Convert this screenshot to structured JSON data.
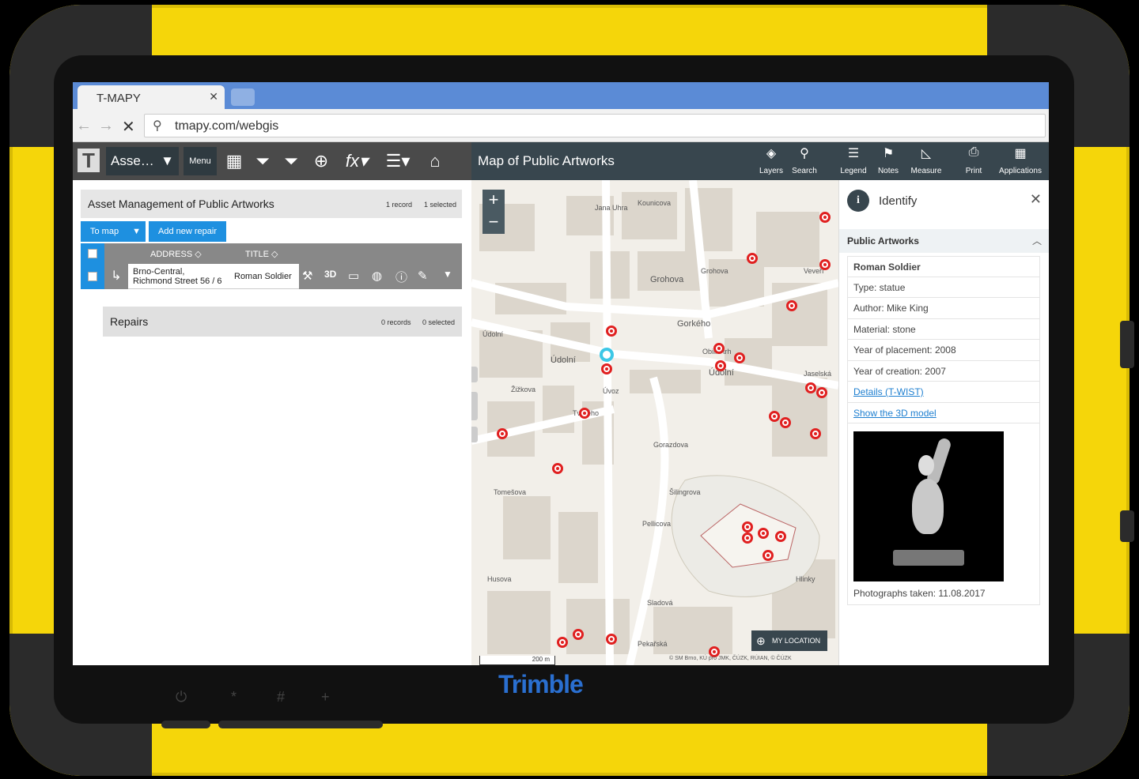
{
  "browser": {
    "tab_title": "T-MAPY",
    "url": "tmapy.com/webgis"
  },
  "device": {
    "brand": "Trimble",
    "frame_color": "#f5d60a"
  },
  "left_toolbar": {
    "asset_dropdown": "Asse…",
    "menu_label": "Menu"
  },
  "asset_panel": {
    "title": "Asset Management of Public Artworks",
    "records": "1 record",
    "selected": "1 selected",
    "to_map_label": "To map",
    "add_repair_label": "Add new repair",
    "columns": [
      "ADDRESS",
      "TITLE"
    ],
    "row": {
      "address_line1": "Brno-Central,",
      "address_line2": "Richmond Street 56 / 6",
      "title": "Roman Soldier"
    }
  },
  "repairs_panel": {
    "title": "Repairs",
    "records": "0 records",
    "selected": "0 selected"
  },
  "map_toolbar": {
    "title": "Map of Public Artworks",
    "buttons": [
      "Layers",
      "Search",
      "Legend",
      "Notes",
      "Measure",
      "Print",
      "Applications"
    ]
  },
  "map": {
    "my_location": "MY LOCATION",
    "scale": "200 m",
    "attribution": "© SM Brno, KÚ pro JMK, ČÚZK, RÚIAN, © ČÚZK",
    "streets": [
      "Jana Uhra",
      "Grohova",
      "Gorkého",
      "Údolní",
      "Obilní trh",
      "Úvoz",
      "Tvrdého",
      "Žižkova",
      "Gorazdova",
      "Tomešova",
      "Pellicova",
      "Šilingrova",
      "Údolní",
      "Pekařská",
      "Hlinky",
      "Sladová",
      "Jaselská",
      "Grohova",
      "Kounicova",
      "Veveří",
      "Husova",
      "Údolní"
    ],
    "accent_color": "#e02020"
  },
  "identify": {
    "title": "Identify",
    "group": "Public Artworks",
    "rows": [
      "Roman Soldier",
      "Type: statue",
      "Author: Mike King",
      "Material: stone",
      "Year of placement: 2008",
      "Year of creation: 2007"
    ],
    "links": [
      "Details (T-WIST)",
      "Show the 3D model"
    ],
    "photo_caption": "Photographs taken: 11.08.2017"
  }
}
